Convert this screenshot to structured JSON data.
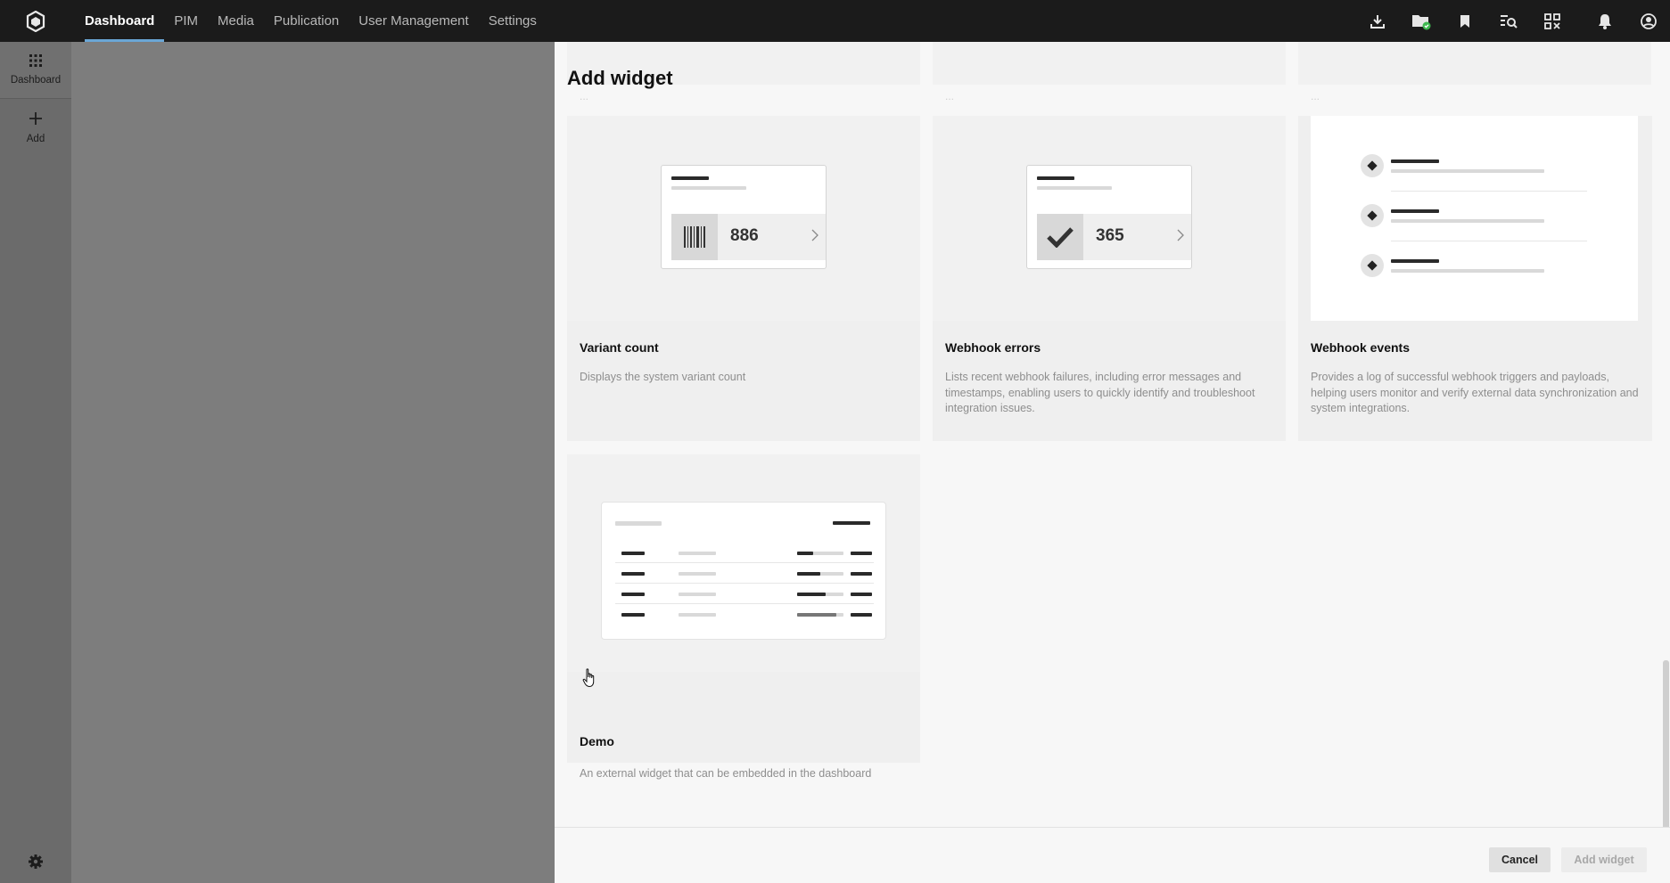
{
  "topbar": {
    "logo_icon": "hexagon-logo-icon",
    "nav": [
      {
        "label": "Dashboard",
        "active": true
      },
      {
        "label": "PIM"
      },
      {
        "label": "Media"
      },
      {
        "label": "Publication"
      },
      {
        "label": "User Management"
      },
      {
        "label": "Settings"
      }
    ],
    "icons": [
      "download-icon",
      "folder-check-icon",
      "bookmark-icon",
      "search-list-icon",
      "qr-scan-icon",
      "bell-icon",
      "user-circle-icon"
    ],
    "badge_color": "#3fb950"
  },
  "sidebar": {
    "items": [
      {
        "label": "Dashboard",
        "icon": "grid-icon"
      },
      {
        "label": "Add",
        "icon": "plus-icon"
      }
    ],
    "settings_icon": "gear-icon"
  },
  "drawer": {
    "title": "Add widget",
    "partial_above": [
      "...",
      "...",
      "..."
    ],
    "cards": [
      {
        "title": "Variant count",
        "description": "Displays the system variant count",
        "preview_value": "886",
        "preview_icon": "barcode-icon"
      },
      {
        "title": "Webhook errors",
        "description": "Lists recent webhook failures, including error messages and timestamps, enabling users to quickly identify and troubleshoot integration issues.",
        "preview_value": "365",
        "preview_icon": "checkmark-icon"
      },
      {
        "title": "Webhook events",
        "description": "Provides a log of successful webhook triggers and payloads, helping users monitor and verify external data synchronization and system integrations."
      },
      {
        "title": "Demo",
        "description": "An external widget that can be embedded in the dashboard"
      }
    ],
    "footer": {
      "cancel_label": "Cancel",
      "add_label": "Add widget"
    }
  }
}
